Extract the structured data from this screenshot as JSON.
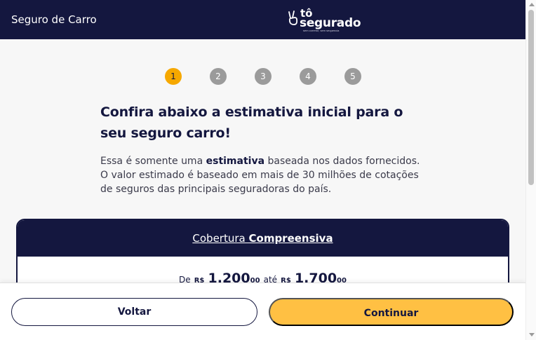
{
  "header": {
    "title": "Seguro de Carro",
    "logo": {
      "line1": "tô",
      "line2": "segurado",
      "tagline": "sem corretor, sem sequencia",
      "icon": "peace-hand-icon"
    }
  },
  "steps": [
    {
      "label": "1",
      "active": true
    },
    {
      "label": "2",
      "active": false
    },
    {
      "label": "3",
      "active": false
    },
    {
      "label": "4",
      "active": false
    },
    {
      "label": "5",
      "active": false
    }
  ],
  "main": {
    "heading": "Confira abaixo a estimativa inicial para o seu seguro carro!",
    "desc_before": "Essa é somente uma ",
    "desc_bold": "estimativa",
    "desc_after": " baseada nos dados fornecidos. O valor estimado é baseado em mais de 30 milhões de cotações de seguros das principais seguradoras do país."
  },
  "card": {
    "title_prefix": "Cobertura ",
    "title_bold": "Compreensiva",
    "price": {
      "from_label": "De",
      "currency1": "R$",
      "min": "1.200",
      "min_cents": "00",
      "to_label": "até",
      "currency2": "R$",
      "max": "1.700",
      "max_cents": "00"
    }
  },
  "footer": {
    "back_label": "Voltar",
    "next_label": "Continuar"
  },
  "colors": {
    "navy": "#14173f",
    "accent": "#ffc043",
    "active_step": "#f6a800",
    "inactive_step": "#9b9b9b"
  }
}
